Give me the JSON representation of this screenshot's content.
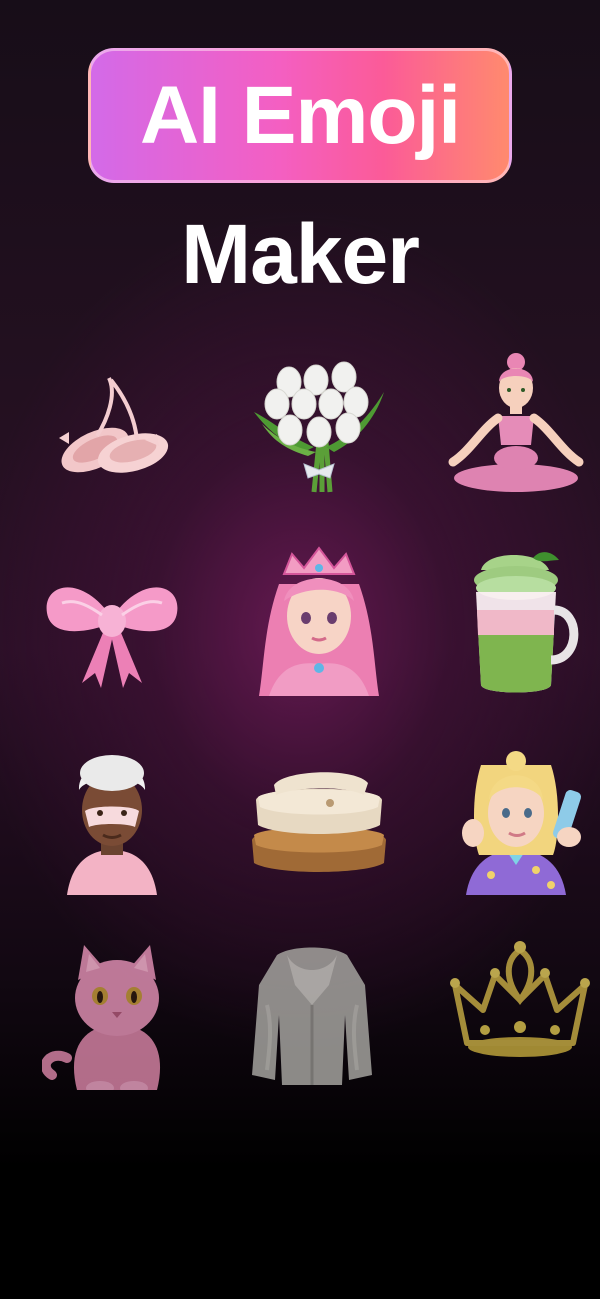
{
  "header": {
    "title": "AI Emoji",
    "subtitle": "Maker"
  },
  "emojis": [
    {
      "icon": "ballet-shoes-icon"
    },
    {
      "icon": "white-tulips-bouquet-icon"
    },
    {
      "icon": "yoga-woman-icon"
    },
    {
      "icon": "pink-bow-icon"
    },
    {
      "icon": "pink-princess-icon"
    },
    {
      "icon": "matcha-latte-icon"
    },
    {
      "icon": "face-mask-woman-icon"
    },
    {
      "icon": "folded-blankets-icon"
    },
    {
      "icon": "skincare-woman-icon"
    },
    {
      "icon": "pink-cat-icon"
    },
    {
      "icon": "fur-coat-icon"
    },
    {
      "icon": "gold-crown-icon"
    }
  ],
  "colors": {
    "gradient_start": "#d36ae8",
    "gradient_mid": "#f45fc2",
    "gradient_end": "#ff8a6e",
    "background": "#1c0d1b"
  }
}
